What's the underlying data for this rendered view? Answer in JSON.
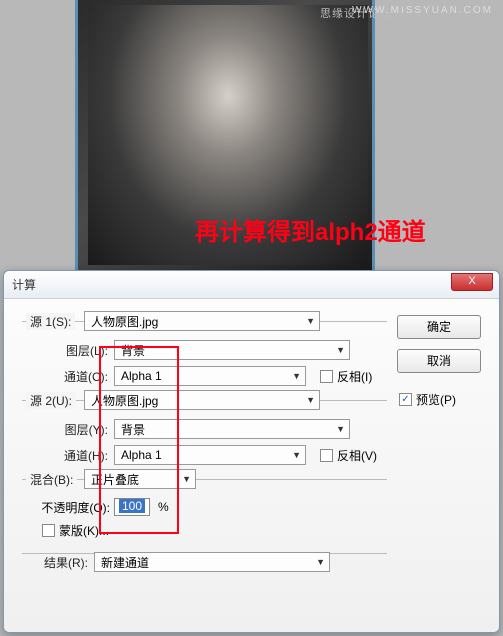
{
  "watermarks": {
    "top": "思缘设计论坛",
    "url": "WWW.MISSYUAN.COM"
  },
  "annotation": "再计算得到alph2通道",
  "dialog": {
    "title": "计算",
    "close_x": "X",
    "buttons": {
      "ok": "确定",
      "cancel": "取消"
    },
    "preview": {
      "label": "预览(P)",
      "checked": true
    },
    "source1": {
      "group_label": "源 1(S):",
      "source_value": "人物原图.jpg",
      "layer_label": "图层(L):",
      "layer_value": "背景",
      "channel_label": "通道(C):",
      "channel_value": "Alpha 1",
      "invert_label": "反相(I)",
      "invert_checked": false
    },
    "source2": {
      "group_label": "源 2(U):",
      "source_value": "人物原图.jpg",
      "layer_label": "图层(Y):",
      "layer_value": "背景",
      "channel_label": "通道(H):",
      "channel_value": "Alpha 1",
      "invert_label": "反相(V)",
      "invert_checked": false
    },
    "blend": {
      "label": "混合(B):",
      "value": "正片叠底"
    },
    "opacity": {
      "label": "不透明度(O):",
      "value": "100",
      "unit": "%"
    },
    "mask": {
      "label": "蒙版(K)...",
      "checked": false
    },
    "result": {
      "label": "结果(R):",
      "value": "新建通道"
    }
  }
}
